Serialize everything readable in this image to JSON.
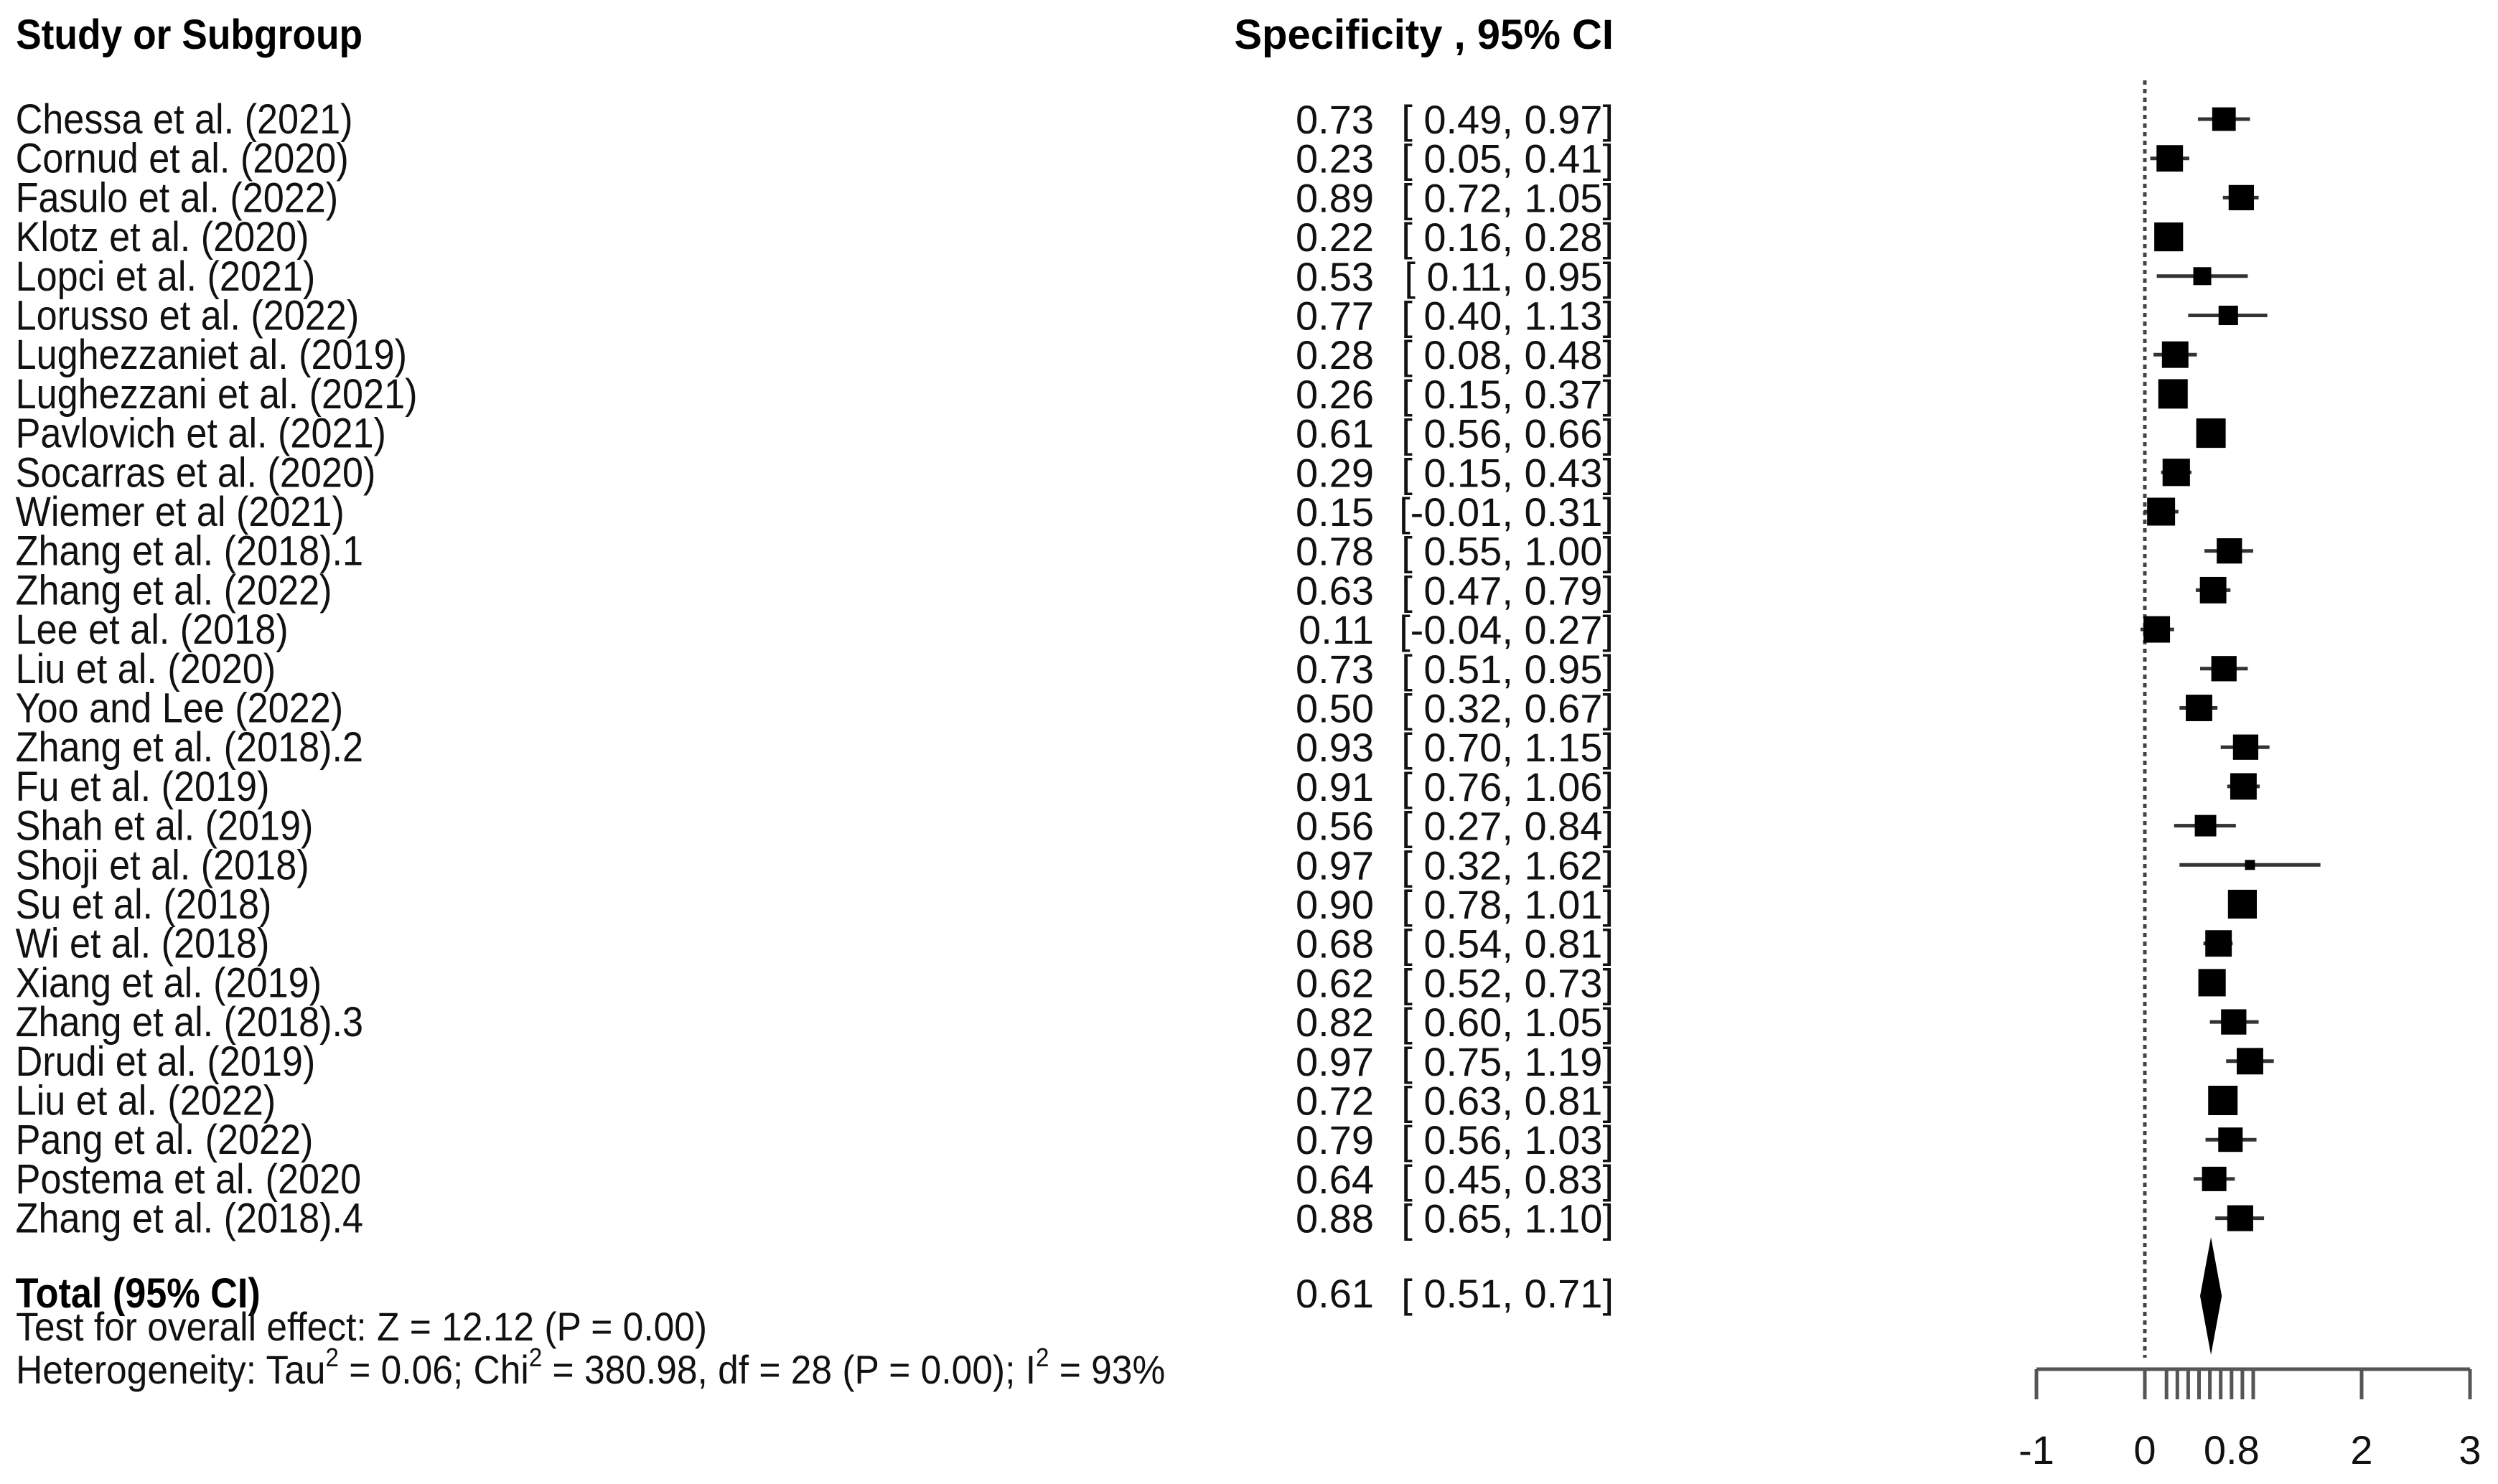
{
  "chart_data": {
    "type": "forest",
    "header": {
      "study_col": "Study or Subgroup",
      "effect_col": "Specificity , 95% CI"
    },
    "studies": [
      {
        "name": "Chessa et al. (2021)",
        "est": 0.73,
        "lo": 0.49,
        "hi": 0.97,
        "ci_text": "[ 0.49, 0.97]",
        "weight": 0.8
      },
      {
        "name": "Cornud et al. (2020)",
        "est": 0.23,
        "lo": 0.05,
        "hi": 0.41,
        "ci_text": "[ 0.05, 0.41]",
        "weight": 0.9
      },
      {
        "name": "Fasulo et al. (2022)",
        "est": 0.89,
        "lo": 0.72,
        "hi": 1.05,
        "ci_text": "[ 0.72, 1.05]",
        "weight": 0.86
      },
      {
        "name": "Klotz et al. (2020)",
        "est": 0.22,
        "lo": 0.16,
        "hi": 0.28,
        "ci_text": "[ 0.16, 0.28]",
        "weight": 0.98
      },
      {
        "name": "Lopci et al. (2021)",
        "est": 0.53,
        "lo": 0.11,
        "hi": 0.95,
        "ci_text": "[ 0.11, 0.95]",
        "weight": 0.61
      },
      {
        "name": "Lorusso et al. (2022)",
        "est": 0.77,
        "lo": 0.4,
        "hi": 1.13,
        "ci_text": "[ 0.40, 1.13]",
        "weight": 0.66
      },
      {
        "name": "Lughezzaniet al. (2019)",
        "est": 0.28,
        "lo": 0.08,
        "hi": 0.48,
        "ci_text": "[ 0.08, 0.48]",
        "weight": 0.9
      },
      {
        "name": "Lughezzani et al. (2021)",
        "est": 0.26,
        "lo": 0.15,
        "hi": 0.37,
        "ci_text": "[ 0.15, 0.37]",
        "weight": 1.0
      },
      {
        "name": "Pavlovich et al. (2021)",
        "est": 0.61,
        "lo": 0.56,
        "hi": 0.66,
        "ci_text": "[ 0.56, 0.66]",
        "weight": 1.0
      },
      {
        "name": "Socarras et al. (2020)",
        "est": 0.29,
        "lo": 0.15,
        "hi": 0.43,
        "ci_text": "[ 0.15, 0.43]",
        "weight": 0.93
      },
      {
        "name": "Wiemer et al (2021)",
        "est": 0.15,
        "lo": -0.01,
        "hi": 0.31,
        "ci_text": "[-0.01, 0.31]",
        "weight": 0.95
      },
      {
        "name": "Zhang et al. (2018).1",
        "est": 0.78,
        "lo": 0.55,
        "hi": 1.0,
        "ci_text": "[ 0.55, 1.00]",
        "weight": 0.86
      },
      {
        "name": "Zhang et al. (2022)",
        "est": 0.63,
        "lo": 0.47,
        "hi": 0.79,
        "ci_text": "[ 0.47, 0.79]",
        "weight": 0.9
      },
      {
        "name": "Lee et al. (2018)",
        "est": 0.11,
        "lo": -0.04,
        "hi": 0.27,
        "ci_text": "[-0.04, 0.27]",
        "weight": 0.9
      },
      {
        "name": "Liu et al. (2020)",
        "est": 0.73,
        "lo": 0.51,
        "hi": 0.95,
        "ci_text": "[ 0.51, 0.95]",
        "weight": 0.86
      },
      {
        "name": "Yoo and Lee (2022)",
        "est": 0.5,
        "lo": 0.32,
        "hi": 0.67,
        "ci_text": "[ 0.32, 0.67]",
        "weight": 0.9
      },
      {
        "name": "Zhang et al. (2018).2",
        "est": 0.93,
        "lo": 0.7,
        "hi": 1.15,
        "ci_text": "[ 0.70, 1.15]",
        "weight": 0.86
      },
      {
        "name": "Fu et al. (2019)",
        "est": 0.91,
        "lo": 0.76,
        "hi": 1.06,
        "ci_text": "[ 0.76, 1.06]",
        "weight": 0.9
      },
      {
        "name": "Shah et al. (2019)",
        "est": 0.56,
        "lo": 0.27,
        "hi": 0.84,
        "ci_text": "[ 0.27, 0.84]",
        "weight": 0.73
      },
      {
        "name": "Shoji et al. (2018)",
        "est": 0.97,
        "lo": 0.32,
        "hi": 1.62,
        "ci_text": "[ 0.32, 1.62]",
        "weight": 0.34
      },
      {
        "name": "Su et al. (2018)",
        "est": 0.9,
        "lo": 0.78,
        "hi": 1.01,
        "ci_text": "[ 0.78, 1.01]",
        "weight": 0.98
      },
      {
        "name": "Wi et al. (2018)",
        "est": 0.68,
        "lo": 0.54,
        "hi": 0.81,
        "ci_text": "[ 0.54, 0.81]",
        "weight": 0.9
      },
      {
        "name": "Xiang et al. (2019)",
        "est": 0.62,
        "lo": 0.52,
        "hi": 0.73,
        "ci_text": "[ 0.52, 0.73]",
        "weight": 0.93
      },
      {
        "name": "Zhang et al. (2018).3",
        "est": 0.82,
        "lo": 0.6,
        "hi": 1.05,
        "ci_text": "[ 0.60, 1.05]",
        "weight": 0.86
      },
      {
        "name": "Drudi et al. (2019)",
        "est": 0.97,
        "lo": 0.75,
        "hi": 1.19,
        "ci_text": "[ 0.75, 1.19]",
        "weight": 0.9
      },
      {
        "name": "Liu et al. (2022)",
        "est": 0.72,
        "lo": 0.63,
        "hi": 0.81,
        "ci_text": "[ 0.63, 0.81]",
        "weight": 1.0
      },
      {
        "name": "Pang et al. (2022)",
        "est": 0.79,
        "lo": 0.56,
        "hi": 1.03,
        "ci_text": "[ 0.56, 1.03]",
        "weight": 0.83
      },
      {
        "name": "Postema et al. (2020",
        "est": 0.64,
        "lo": 0.45,
        "hi": 0.83,
        "ci_text": "[ 0.45, 0.83]",
        "weight": 0.83
      },
      {
        "name": "Zhang et al. (2018).4",
        "est": 0.88,
        "lo": 0.65,
        "hi": 1.1,
        "ci_text": "[ 0.65, 1.10]",
        "weight": 0.88
      }
    ],
    "total": {
      "label": "Total (95% CI)",
      "est": 0.61,
      "lo": 0.51,
      "hi": 0.71,
      "ci_text": "[ 0.51, 0.71]"
    },
    "footer": {
      "overall_effect": "Test for overall effect: Z = 12.12 (P = 0.00)",
      "heterogeneity_prefix": "Heterogeneity: Tau",
      "heterogeneity_tau_val": " = 0.06; Chi",
      "heterogeneity_chi_val": " = 380.98, df = 28 (P = 0.00); I",
      "heterogeneity_i_val": " = 93%",
      "superscript": "2"
    },
    "x_axis": {
      "range": [
        -1,
        3
      ],
      "major_ticks": [
        -1,
        0,
        2,
        3
      ],
      "minor_ticks": [
        0.2,
        0.3,
        0.4,
        0.5,
        0.6,
        0.7,
        0.8,
        0.9,
        1.0
      ],
      "tick_labels": [
        {
          "value": -1,
          "label": "-1"
        },
        {
          "value": 0,
          "label": "0"
        },
        {
          "value": 0.8,
          "label": "0.8"
        },
        {
          "value": 2,
          "label": "2"
        },
        {
          "value": 3,
          "label": "3"
        }
      ],
      "reference_line": 0,
      "reference_line_style": "dotted"
    },
    "colors": {
      "marker": "#000000",
      "ci_line": "#333333",
      "axis": "#555555",
      "text": "#111111"
    }
  }
}
